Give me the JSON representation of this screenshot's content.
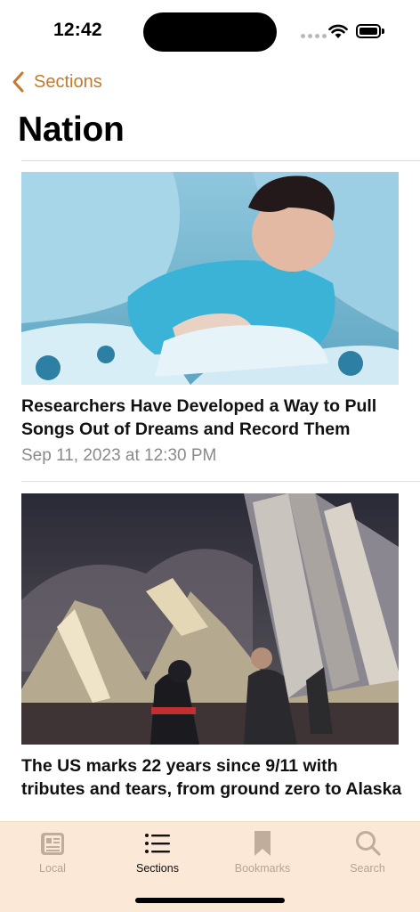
{
  "status_bar": {
    "time": "12:42"
  },
  "nav": {
    "back_label": "Sections",
    "title": "Nation"
  },
  "articles": [
    {
      "headline": "Researchers Have Developed a Way to Pull Songs Out of Dreams and Record Them",
      "date": "Sep 11, 2023 at 12:30 PM",
      "image": "man-sleeping-in-bed-photo"
    },
    {
      "headline": "The US marks 22 years since 9/11 with tributes and tears, from ground zero to Alaska",
      "image": "ground-zero-wreckage-photo"
    }
  ],
  "tab_bar": {
    "tabs": [
      {
        "label": "Local",
        "icon": "newspaper-icon",
        "active": false
      },
      {
        "label": "Sections",
        "icon": "list-icon",
        "active": true
      },
      {
        "label": "Bookmarks",
        "icon": "bookmark-icon",
        "active": false
      },
      {
        "label": "Search",
        "icon": "search-icon",
        "active": false
      }
    ]
  },
  "colors": {
    "accent": "#c27a2e",
    "tab_bar_bg": "#fbe8d6",
    "inactive_tab": "#b7a493",
    "date_gray": "#8a8a8a"
  }
}
